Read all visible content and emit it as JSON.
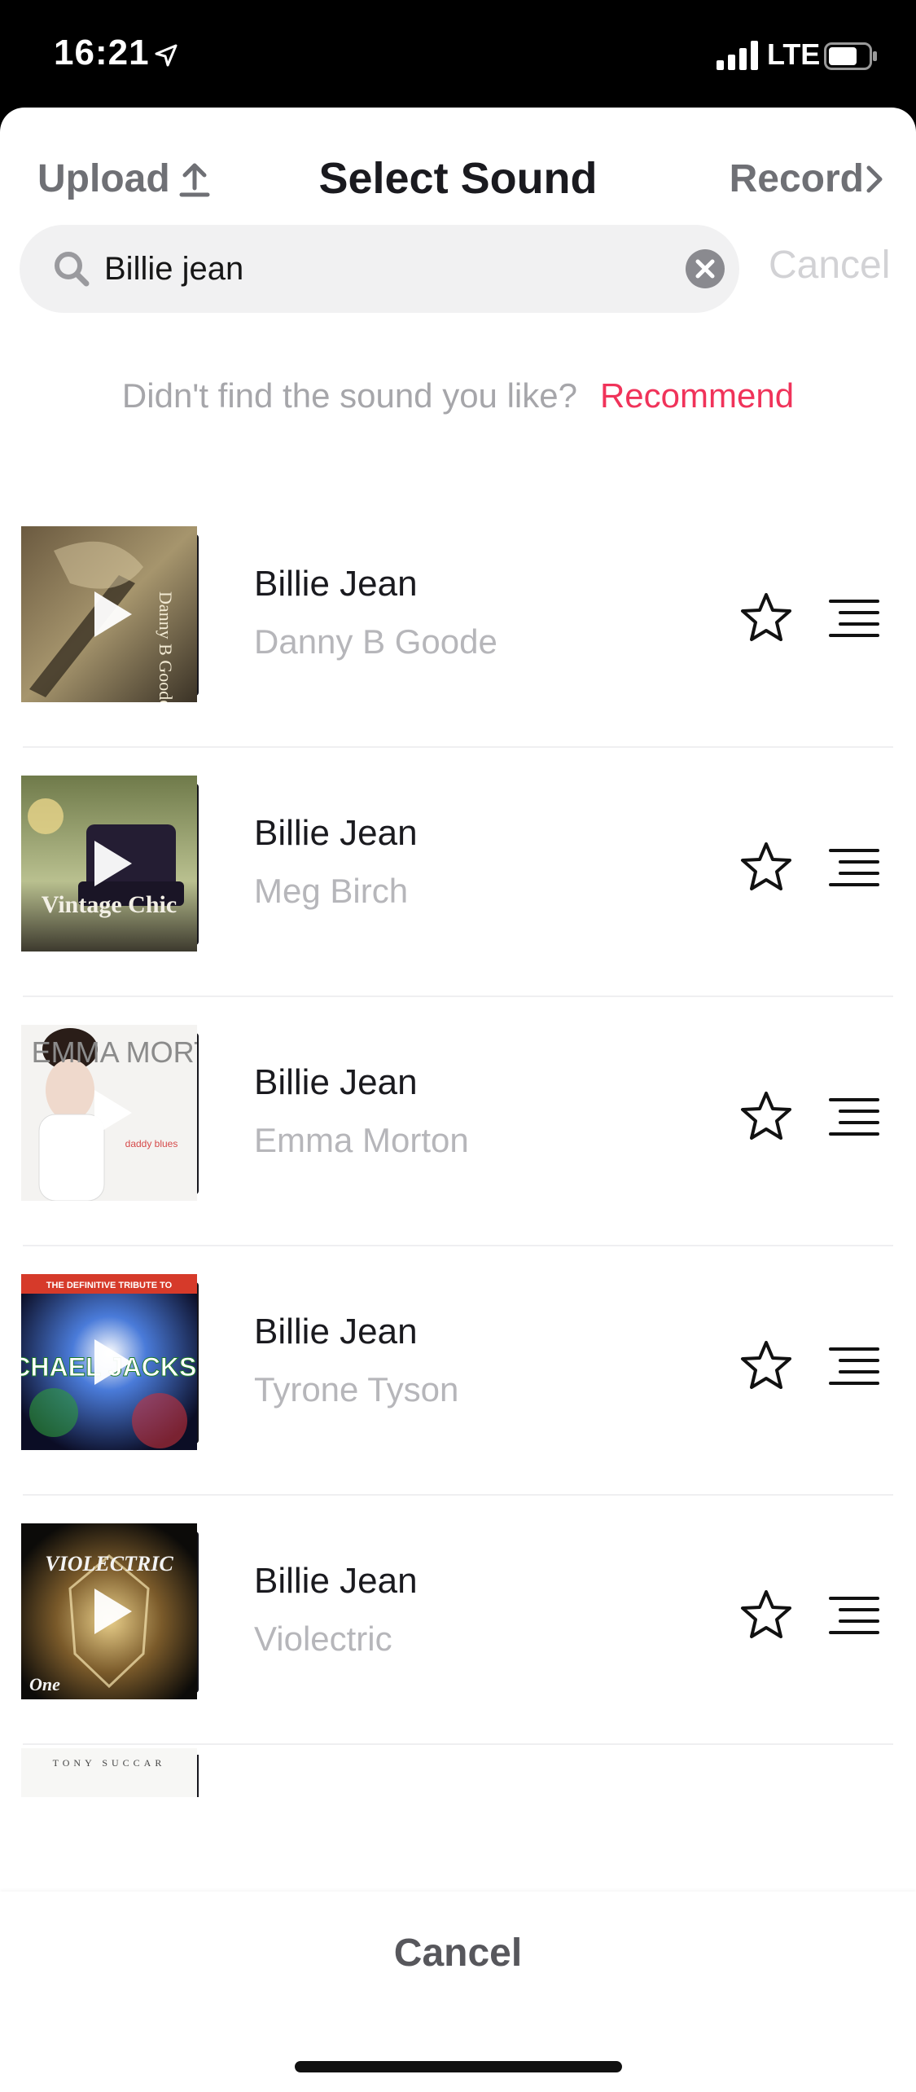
{
  "status_bar": {
    "time": "16:21",
    "network": "LTE"
  },
  "header": {
    "upload_label": "Upload",
    "title": "Select Sound",
    "record_label": "Record"
  },
  "search": {
    "value": "Billie jean",
    "placeholder": "",
    "cancel_label": "Cancel"
  },
  "suggest": {
    "question": "Didn't find the sound you like?",
    "recommend_label": "Recommend"
  },
  "colors": {
    "accent": "#f0335a",
    "muted_text": "#b6b6ba",
    "primary_text": "#1a1a1f"
  },
  "results": [
    {
      "title": "Billie Jean",
      "artist": "Danny B Goode",
      "cover_text": "Danny B Goode"
    },
    {
      "title": "Billie Jean",
      "artist": "Meg Birch",
      "cover_text": "Vintage Chic"
    },
    {
      "title": "Billie Jean",
      "artist": "Emma Morton",
      "cover_text": "EMMA MORTON",
      "cover_subtext": "daddy blues"
    },
    {
      "title": "Billie Jean",
      "artist": "Tyrone Tyson",
      "cover_text": "MICHAEL JACKSON",
      "cover_subtext": "THE DEFINITIVE TRIBUTE TO"
    },
    {
      "title": "Billie Jean",
      "artist": "Violectric",
      "cover_text": "VIOLECTRIC",
      "cover_subtext": "One"
    }
  ],
  "partial_item": {
    "cover_text": "TONY SUCCAR"
  },
  "bottom": {
    "cancel_label": "Cancel"
  }
}
